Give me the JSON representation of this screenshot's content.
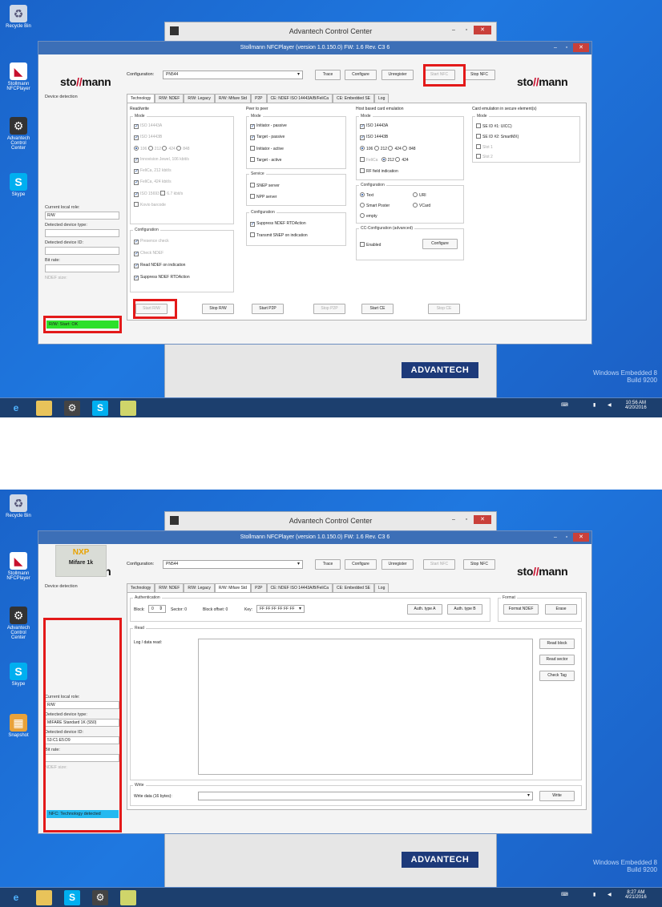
{
  "desktop": {
    "icons": [
      "Recycle Bin",
      "Stollmann NFCPlayer",
      "Advantech Control Center",
      "Skype"
    ],
    "icons2": [
      "Recycle Bin",
      "Stollmann NFCPlayer",
      "Advantech Control Center",
      "Skype",
      "Snapshot"
    ],
    "watermark_line1": "Windows Embedded 8",
    "watermark_line2": "Build 9200"
  },
  "colors": {
    "desktop": "#1f78e0",
    "titlebar": "#3c6fb7",
    "highlight": "#e31919",
    "status_ok": "#2de02a",
    "status_info": "#25b9f0"
  },
  "acc": {
    "title": "Advantech Control Center",
    "brand": "ADVANTECH"
  },
  "app": {
    "title": "Stollmann NFCPlayer (version 1.0.150.0)   FW: 1.6 Rev. C3 6",
    "logo_a": "sto",
    "logo_b": "mann",
    "device_detection": "Device detection",
    "config_label": "Configuration:",
    "config_value": "PN544",
    "btn_trace": "Trace",
    "btn_configure": "Configure",
    "btn_unregister": "Unregister",
    "btn_start_nfc": "Start NFC",
    "btn_stop_nfc": "Stop NFC",
    "tabs": [
      "Technology",
      "R/W: NDEF",
      "R/W: Legacy",
      "R/W: Mifare Std",
      "P2P",
      "CE: NDEF ISO 14443A/B/FeliCa",
      "CE: Embedded SE",
      "Log"
    ],
    "role_label": "Current local role:",
    "type_label": "Detected device type:",
    "id_label": "Detected device ID:",
    "bitrate_label": "Bit rate:",
    "ndef_label": "NDEF size:"
  },
  "screen1": {
    "role_value": "R/W",
    "status": "R/W: Start: OK",
    "clock_time": "10:56 AM",
    "clock_date": "4/20/2016",
    "rw": {
      "title": "Read/write",
      "mode": "Mode",
      "items": [
        "ISO 14443A",
        "ISO 14443B",
        "106",
        "212",
        "424",
        "848",
        "Innovision Jewel, 106 kbit/s",
        "FeliCa, 212 kbit/s",
        "FeliCa, 424 kbit/s",
        "ISO 15693",
        "6.7 kbit/s",
        "Kovio barcode"
      ],
      "config": "Configuration",
      "config_items": [
        "Presence check",
        "Check NDEF",
        "Read NDEF on indication",
        "Suppress NDEF RTDAction"
      ],
      "start": "Start R/W",
      "stop": "Stop R/W"
    },
    "p2p": {
      "title": "Peer to peer",
      "mode": "Mode",
      "items": [
        "Initiator - passive",
        "Target - passive",
        "Initiator - active",
        "Target - active"
      ],
      "service": "Service",
      "service_items": [
        "SNEP server",
        "NPP server"
      ],
      "config": "Configuration",
      "config_items": [
        "Suppress NDEF RTDAction",
        "Transmit SNEP on indication"
      ],
      "start": "Start P2P",
      "stop": "Stop P2P"
    },
    "hce": {
      "title": "Host based card emulation",
      "mode": "Mode",
      "items": [
        "ISO 14443A",
        "ISO 14443B",
        "106",
        "212",
        "424",
        "848",
        "FeliCa",
        "212",
        "424",
        "RF field indication"
      ],
      "config": "Configuration",
      "config_items": [
        "Text",
        "URI",
        "Smart Poster",
        "VCard",
        "empty"
      ],
      "cc": "CC-Configuration (advanced)",
      "enabled": "Enabled",
      "configure": "Configure",
      "start": "Start CE",
      "stop": "Stop CE"
    },
    "se": {
      "title": "Card emulation in secure element(s)",
      "mode": "Mode",
      "items": [
        "SE ID #1: UICC)",
        "SE ID #2: SmartMX)",
        "Slot 1",
        "Slot 2"
      ]
    }
  },
  "screen2": {
    "nxp_text": "NXP",
    "card_name": "Mifare 1k",
    "role_value": "R/W",
    "type_value": "MIFARE Standard 1K (S50)",
    "id_value": "53:C1:E5:D9",
    "status": "NFC: Technology detected",
    "clock_time": "8:27 AM",
    "clock_date": "4/21/2016",
    "auth": {
      "title": "Authentication",
      "block_label": "Block:",
      "block_value": "0",
      "sector": "Sector: 0",
      "offset": "Block offset: 0",
      "key_label": "Key:",
      "key_value": "FF FF FF FF FF FF",
      "auth_a": "Auth. type A",
      "auth_b": "Auth. type B"
    },
    "format": {
      "title": "Format",
      "format_ndef": "Format NDEF",
      "erase": "Erase"
    },
    "read": {
      "title": "Read",
      "log_label": "Log / data read:",
      "read_block": "Read block",
      "read_sector": "Read sector",
      "check_tag": "Check Tag"
    },
    "write": {
      "title": "Write",
      "data_label": "Write data (16 bytes):",
      "write_btn": "Write"
    }
  }
}
